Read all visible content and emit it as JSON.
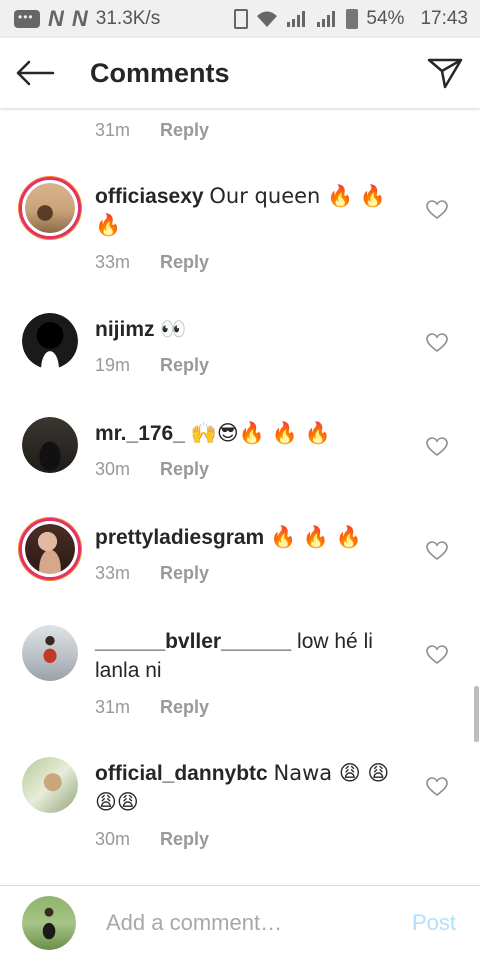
{
  "status_bar": {
    "speed": "31.3K/s",
    "battery": "54%",
    "time": "17:43"
  },
  "header": {
    "title": "Comments"
  },
  "top_partial": {
    "time": "31m",
    "reply": "Reply"
  },
  "comments": [
    {
      "username": "officiasexy",
      "text": "Our queen 🔥 🔥 🔥",
      "time": "33m",
      "reply": "Reply",
      "avatar_story_ring": true,
      "avatar_color": "#c9a37a"
    },
    {
      "username": "nijimz",
      "text": "👀",
      "time": "19m",
      "reply": "Reply",
      "avatar_story_ring": false,
      "avatar_color": "#1a1a1a"
    },
    {
      "username": "mr._176_",
      "text": "🙌😎🔥 🔥 🔥",
      "time": "30m",
      "reply": "Reply",
      "avatar_story_ring": false,
      "avatar_color": "#2a2622"
    },
    {
      "username": "prettyladiesgram",
      "text": "🔥 🔥 🔥",
      "time": "33m",
      "reply": "Reply",
      "avatar_story_ring": true,
      "avatar_color": "#6e4a3c"
    },
    {
      "username": "______bvller______",
      "text": "low hé li lanla ni",
      "time": "31m",
      "reply": "Reply",
      "avatar_story_ring": false,
      "avatar_color": "#c8cdd2"
    },
    {
      "username": "official_dannybtc",
      "text": "Nawa 😩 😩😩😩",
      "time": "30m",
      "reply": "Reply",
      "avatar_story_ring": false,
      "avatar_color": "#9fb58a"
    }
  ],
  "composer": {
    "placeholder": "Add a comment…",
    "post_label": "Post"
  },
  "colors": {
    "text_primary": "#262626",
    "text_secondary": "#999999",
    "post_disabled": "#b2dffc",
    "story_ring": "#e1306c"
  }
}
